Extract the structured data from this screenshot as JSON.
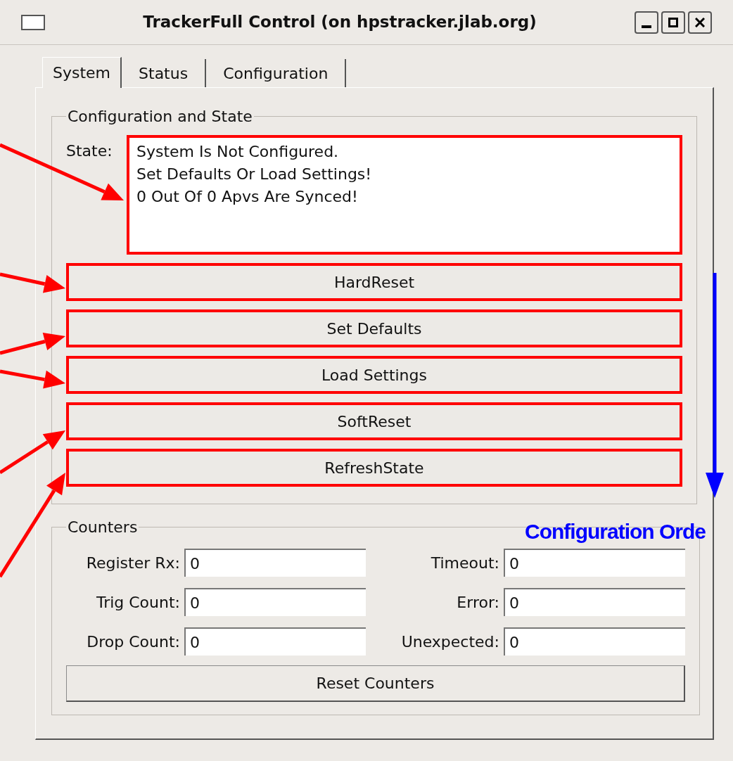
{
  "window": {
    "title": "TrackerFull Control (on hpstracker.jlab.org)"
  },
  "tabs": [
    {
      "label": "System",
      "selected": true
    },
    {
      "label": "Status",
      "selected": false
    },
    {
      "label": "Configuration",
      "selected": false
    }
  ],
  "config_group": {
    "title": "Configuration and State",
    "state_label": "State:",
    "state_lines": [
      "System Is Not Configured.",
      "Set Defaults Or Load Settings!",
      "0 Out Of 0 Apvs Are Synced!"
    ],
    "state_highlighted": true,
    "buttons": [
      {
        "label": "HardReset",
        "highlighted": true
      },
      {
        "label": "Set Defaults",
        "highlighted": true
      },
      {
        "label": "Load Settings",
        "highlighted": true
      },
      {
        "label": "SoftReset",
        "highlighted": true
      },
      {
        "label": "RefreshState",
        "highlighted": true
      }
    ]
  },
  "counters_group": {
    "title": "Counters",
    "fields": [
      {
        "label": "Register Rx:",
        "value": "0"
      },
      {
        "label": "Timeout:",
        "value": "0"
      },
      {
        "label": "Trig Count:",
        "value": "0"
      },
      {
        "label": "Error:",
        "value": "0"
      },
      {
        "label": "Drop Count:",
        "value": "0"
      },
      {
        "label": "Unexpected:",
        "value": "0"
      }
    ],
    "reset_button": "Reset Counters"
  },
  "annotation": {
    "label": "Configuration Orde"
  }
}
